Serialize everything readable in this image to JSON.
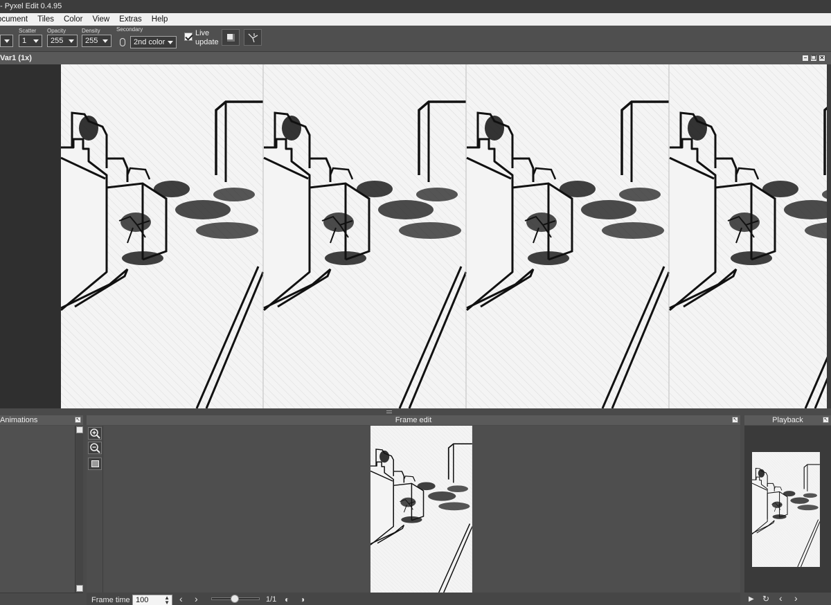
{
  "app": {
    "title": "- Pyxel Edit 0.4.95"
  },
  "menu": {
    "items": [
      "ocument",
      "Tiles",
      "Color",
      "View",
      "Extras",
      "Help"
    ]
  },
  "toolbar": {
    "scatter_label": "Scatter",
    "scatter_value": "1",
    "opacity_label": "Opacity",
    "opacity_value": "255",
    "density_label": "Density",
    "density_value": "255",
    "secondary_label": "Secondary",
    "secondary_value": "2nd color",
    "live_update_line1": "Live",
    "live_update_line2": "update",
    "live_update_checked": true
  },
  "document": {
    "title": "Var1  (1x)"
  },
  "panels": {
    "animations_title": "Animations",
    "frame_edit_title": "Frame edit",
    "playback_title": "Playback"
  },
  "frame_edit": {
    "frame_time_label": "Frame time",
    "frame_time_value": "100",
    "frame_counter": "1/1"
  },
  "colors": {
    "bg": "#4a4a4a",
    "canvas": "#f2f2f2",
    "ink": "#111111"
  }
}
